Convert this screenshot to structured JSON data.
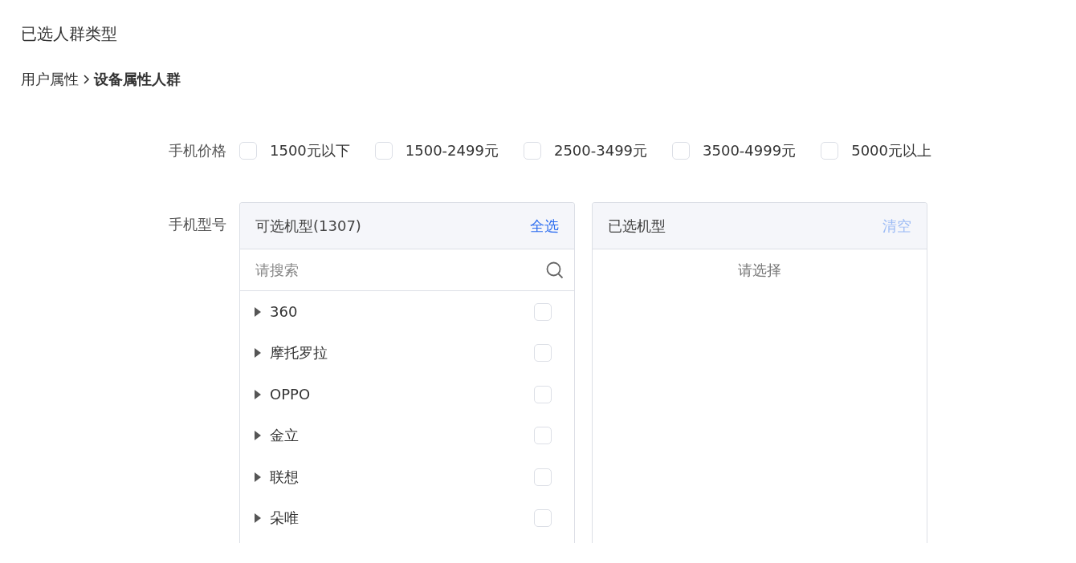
{
  "title": "已选人群类型",
  "breadcrumb": [
    {
      "label": "用户属性",
      "current": false
    },
    {
      "label": "设备属性人群",
      "current": true
    }
  ],
  "price": {
    "label": "手机价格",
    "options": [
      {
        "label": "1500元以下",
        "checked": false
      },
      {
        "label": "1500-2499元",
        "checked": false
      },
      {
        "label": "2500-3499元",
        "checked": false
      },
      {
        "label": "3500-4999元",
        "checked": false
      },
      {
        "label": "5000元以上",
        "checked": false
      }
    ]
  },
  "model": {
    "label": "手机型号",
    "available": {
      "title": "可选机型(1307)",
      "action": "全选",
      "action_disabled": false,
      "search": {
        "placeholder": "请搜索"
      },
      "items": [
        {
          "label": "360",
          "expanded": false,
          "checked": false
        },
        {
          "label": "摩托罗拉",
          "expanded": false,
          "checked": false
        },
        {
          "label": "OPPO",
          "expanded": false,
          "checked": false
        },
        {
          "label": "金立",
          "expanded": false,
          "checked": false
        },
        {
          "label": "联想",
          "expanded": false,
          "checked": false
        },
        {
          "label": "朵唯",
          "expanded": false,
          "checked": false
        }
      ]
    },
    "selected": {
      "title": "已选机型",
      "action": "清空",
      "action_disabled": true,
      "empty_text": "请选择"
    }
  }
}
